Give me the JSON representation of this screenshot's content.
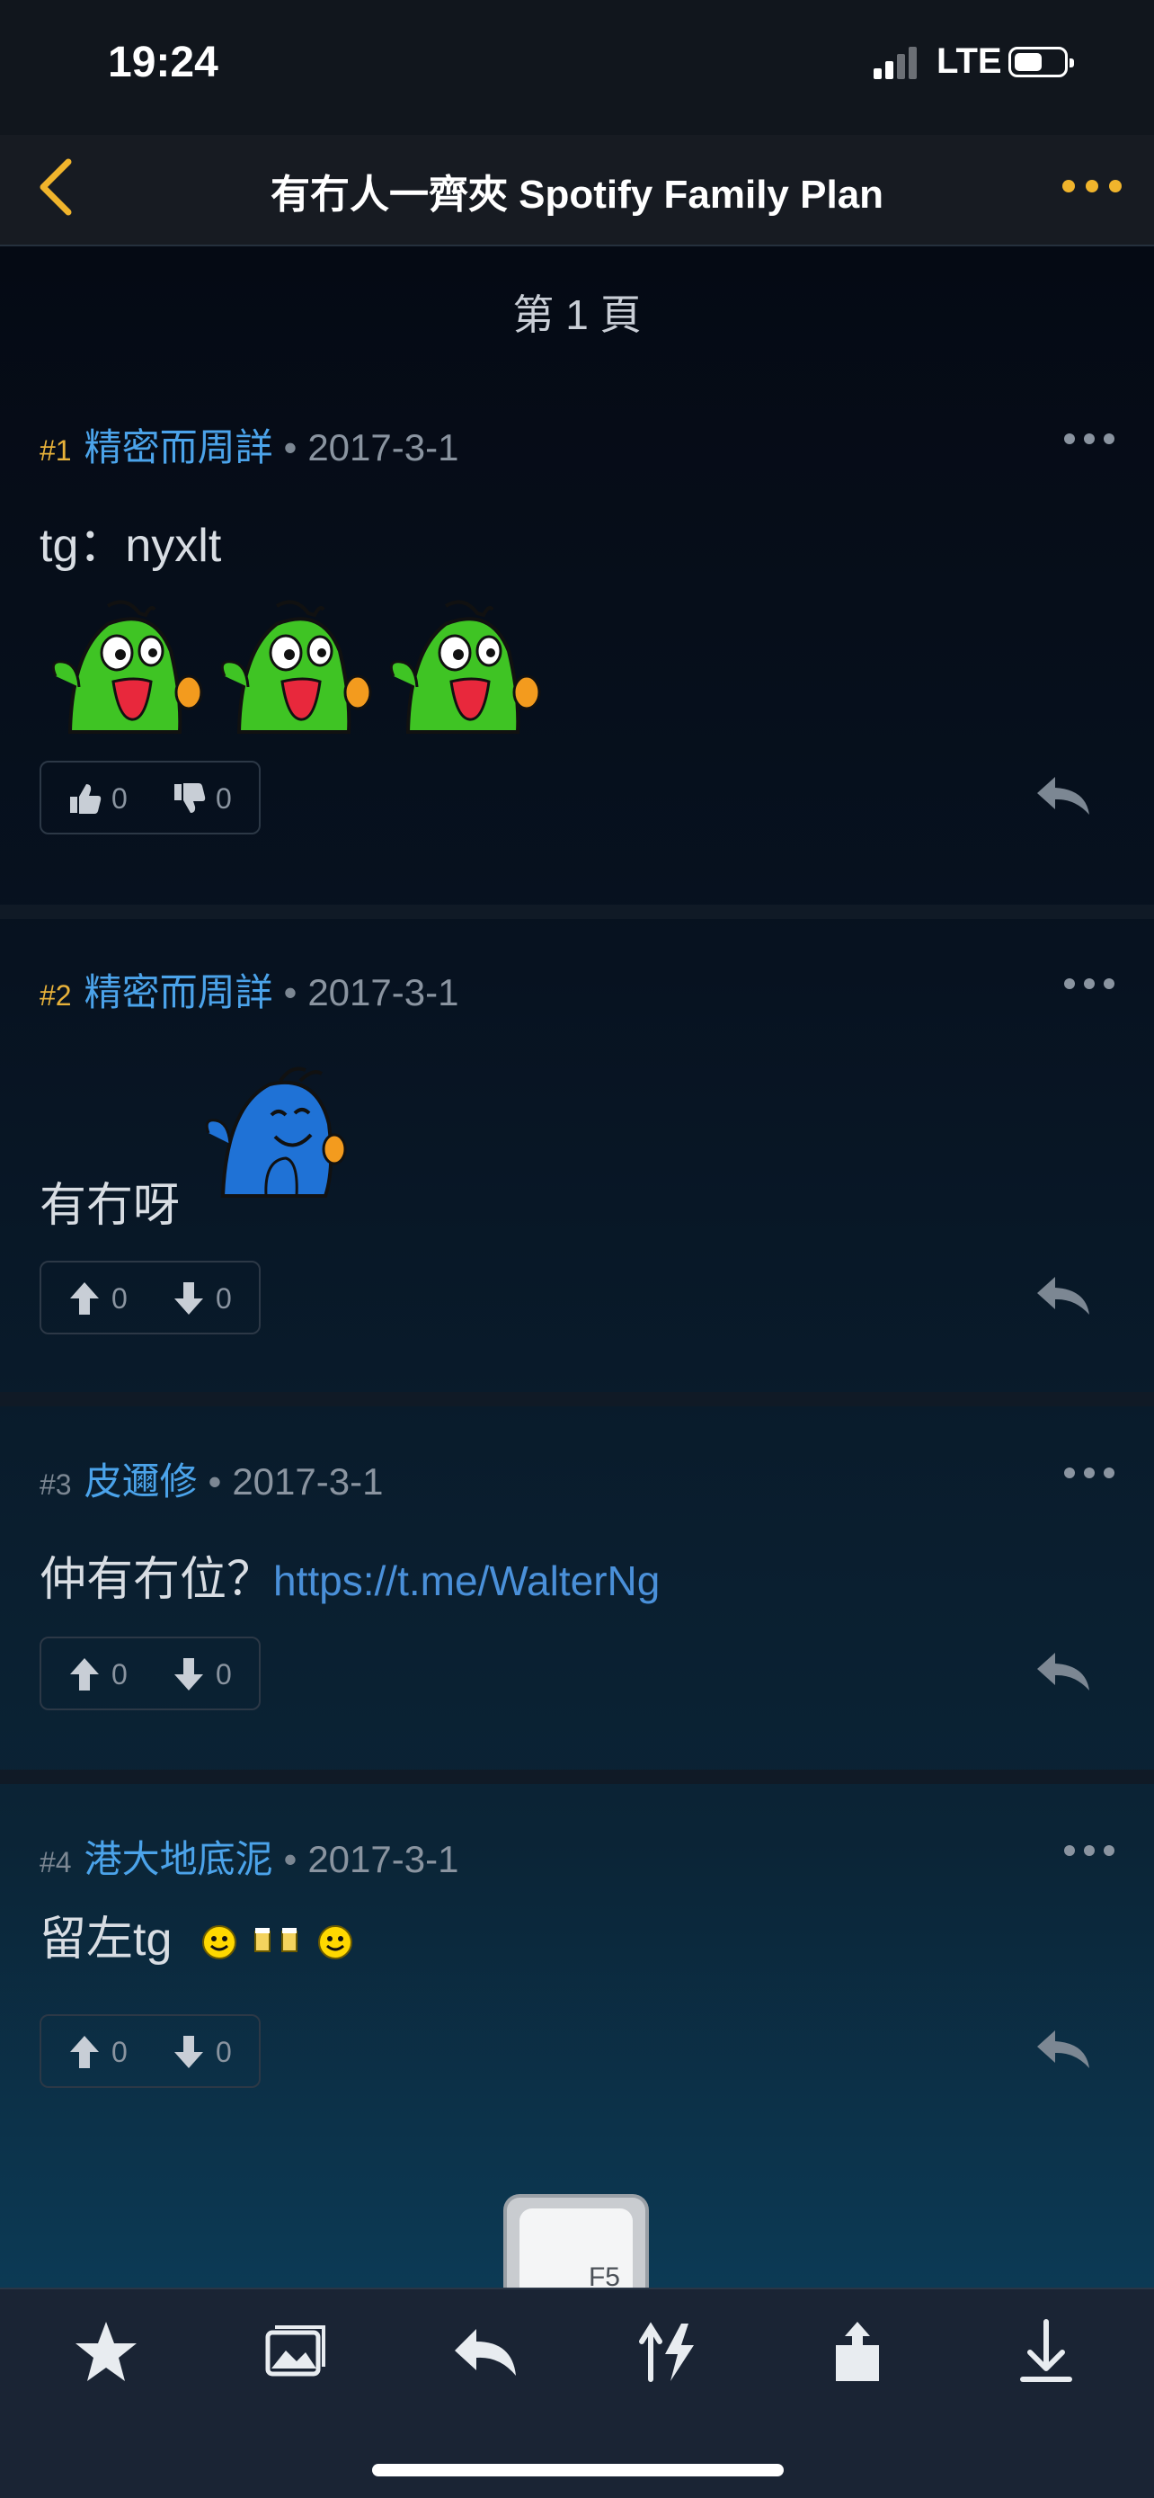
{
  "status_bar": {
    "time": "19:24",
    "network": "LTE"
  },
  "nav": {
    "title": "有冇人一齊夾 Spotify Family Plan"
  },
  "page_label": "第 1 頁",
  "posts": [
    {
      "num": "#1",
      "user": "精密而周詳",
      "date": "2017-3-1",
      "body": "tg：nyxlt",
      "up": "0",
      "down": "0"
    },
    {
      "num": "#2",
      "user": "精密而周詳",
      "date": "2017-3-1",
      "body": "有冇呀",
      "up": "0",
      "down": "0"
    },
    {
      "num": "#3",
      "user": "皮邇修",
      "date": "2017-3-1",
      "body": "仲有冇位？",
      "link": "https://t.me/WalterNg",
      "up": "0",
      "down": "0"
    },
    {
      "num": "#4",
      "user": "港大地底泥",
      "date": "2017-3-1",
      "body": "留左tg",
      "up": "0",
      "down": "0"
    }
  ],
  "keyboard_hint": {
    "label": "F5"
  },
  "colors": {
    "accent": "#f0b42c",
    "username": "#4ba3ea",
    "link": "#4a90d9",
    "post_number_highlight": "#e8b23a"
  },
  "toolbar_icons": [
    "star-icon",
    "gallery-icon",
    "reply-icon",
    "sort-lightning-icon",
    "share-icon",
    "download-icon"
  ]
}
